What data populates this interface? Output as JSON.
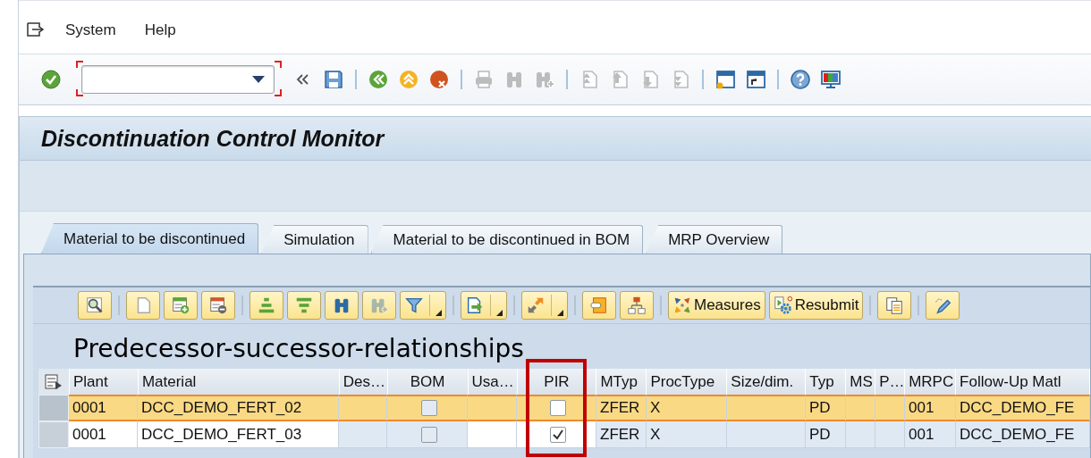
{
  "menu_bar": {
    "items": [
      {
        "label": "System"
      },
      {
        "label": "Help"
      }
    ]
  },
  "toolbar": [
    {
      "kind": "enter",
      "disabled": false
    },
    {
      "kind": "command"
    },
    {
      "kind": "collapse",
      "disabled": false
    },
    {
      "kind": "save",
      "disabled": false
    },
    {
      "kind": "sep"
    },
    {
      "kind": "back",
      "disabled": false
    },
    {
      "kind": "exit",
      "disabled": false
    },
    {
      "kind": "cancel",
      "disabled": false
    },
    {
      "kind": "sep"
    },
    {
      "kind": "print",
      "disabled": true
    },
    {
      "kind": "find",
      "disabled": true
    },
    {
      "kind": "findnext",
      "disabled": true
    },
    {
      "kind": "sep"
    },
    {
      "kind": "first",
      "disabled": true
    },
    {
      "kind": "prev",
      "disabled": true
    },
    {
      "kind": "next",
      "disabled": true
    },
    {
      "kind": "last",
      "disabled": true
    },
    {
      "kind": "sep"
    },
    {
      "kind": "session",
      "disabled": false
    },
    {
      "kind": "shortcut",
      "disabled": false
    },
    {
      "kind": "sep"
    },
    {
      "kind": "help",
      "disabled": false
    },
    {
      "kind": "customize",
      "disabled": false
    }
  ],
  "window": {
    "title": "Discontinuation Control Monitor"
  },
  "tabs": [
    {
      "label": "Material to be discontinued",
      "selected": true
    },
    {
      "label": "Simulation",
      "selected": false
    },
    {
      "label": "Material to be discontinued in BOM",
      "selected": false
    },
    {
      "label": "MRP Overview",
      "selected": false
    }
  ],
  "alv": {
    "toolbar": [
      {
        "kind": "details",
        "disabled": false
      },
      {
        "kind": "sep"
      },
      {
        "kind": "new",
        "disabled": false
      },
      {
        "kind": "insert",
        "disabled": false
      },
      {
        "kind": "delete",
        "disabled": false
      },
      {
        "kind": "sep"
      },
      {
        "kind": "sortasc",
        "disabled": false
      },
      {
        "kind": "sortdesc",
        "disabled": false
      },
      {
        "kind": "find",
        "disabled": false
      },
      {
        "kind": "findnext",
        "disabled": true
      },
      {
        "kind": "filter",
        "disabled": false,
        "menu": true
      },
      {
        "kind": "sep"
      },
      {
        "kind": "export",
        "disabled": false,
        "menu": true
      },
      {
        "kind": "sep"
      },
      {
        "kind": "layout",
        "disabled": false,
        "menu": true
      },
      {
        "kind": "sep"
      },
      {
        "kind": "graphic",
        "disabled": false
      },
      {
        "kind": "hierarchy",
        "disabled": false
      },
      {
        "kind": "sep"
      },
      {
        "kind": "measures",
        "disabled": false,
        "label": "Measures"
      },
      {
        "kind": "resubmit",
        "disabled": false,
        "label": "Resubmit"
      },
      {
        "kind": "sep"
      },
      {
        "kind": "copy",
        "disabled": false
      },
      {
        "kind": "sep"
      },
      {
        "kind": "edit",
        "disabled": false
      }
    ],
    "title": "Predecessor-successor-relationships",
    "columns": [
      {
        "label": "Plant",
        "editable": true,
        "kind": "text"
      },
      {
        "label": "Material",
        "editable": true,
        "kind": "text"
      },
      {
        "label": "Des…",
        "editable": false,
        "kind": "text"
      },
      {
        "label": "BOM",
        "editable": false,
        "kind": "checkbox"
      },
      {
        "label": "Usa…",
        "editable": true,
        "kind": "text"
      },
      {
        "label": "PIR",
        "editable": true,
        "kind": "checkbox",
        "highlighted": true
      },
      {
        "label": "MTyp",
        "editable": false,
        "kind": "text"
      },
      {
        "label": "ProcType",
        "editable": false,
        "kind": "text"
      },
      {
        "label": "Size/dim.",
        "editable": false,
        "kind": "text"
      },
      {
        "label": "Typ",
        "editable": false,
        "kind": "text"
      },
      {
        "label": "MS",
        "editable": false,
        "kind": "text"
      },
      {
        "label": "P…",
        "editable": false,
        "kind": "text"
      },
      {
        "label": "MRPC",
        "editable": false,
        "kind": "text"
      },
      {
        "label": "Follow-Up Matl",
        "editable": false,
        "kind": "text"
      }
    ],
    "rows": [
      {
        "selected": true,
        "cells": [
          "0001",
          "DCC_DEMO_FERT_02",
          "",
          {
            "checked": false
          },
          "",
          {
            "checked": false
          },
          "ZFER",
          "X",
          "",
          "PD",
          "",
          "",
          "001",
          "DCC_DEMO_FE"
        ]
      },
      {
        "selected": false,
        "cells": [
          "0001",
          "DCC_DEMO_FERT_03",
          "",
          {
            "checked": false
          },
          "",
          {
            "checked": true
          },
          "ZFER",
          "X",
          "",
          "PD",
          "",
          "",
          "001",
          "DCC_DEMO_FE"
        ]
      }
    ]
  }
}
